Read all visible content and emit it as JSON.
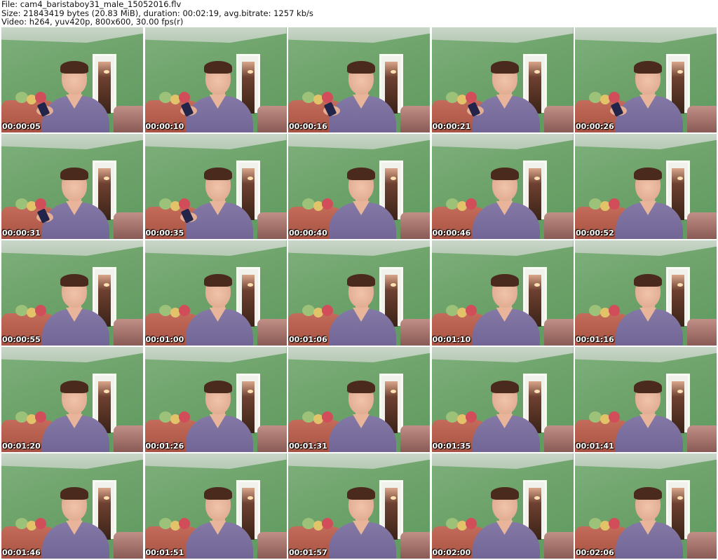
{
  "header": {
    "line1": "File: cam4_baristaboy31_male_15052016.flv",
    "line2": "Size: 21843419 bytes (20.83 MiB), duration: 00:02:19, avg.bitrate: 1257 kb/s",
    "line3": "Video: h264, yuv420p, 800x600, 30.00 fps(r)"
  },
  "frames": [
    {
      "timestamp": "00:00:05",
      "phone": true
    },
    {
      "timestamp": "00:00:10",
      "phone": true
    },
    {
      "timestamp": "00:00:16",
      "phone": true
    },
    {
      "timestamp": "00:00:21",
      "phone": true
    },
    {
      "timestamp": "00:00:26",
      "phone": true
    },
    {
      "timestamp": "00:00:31",
      "phone": true
    },
    {
      "timestamp": "00:00:35",
      "phone": true
    },
    {
      "timestamp": "00:00:40",
      "phone": false
    },
    {
      "timestamp": "00:00:46",
      "phone": false
    },
    {
      "timestamp": "00:00:52",
      "phone": false
    },
    {
      "timestamp": "00:00:55",
      "phone": false
    },
    {
      "timestamp": "00:01:00",
      "phone": false
    },
    {
      "timestamp": "00:01:06",
      "phone": false
    },
    {
      "timestamp": "00:01:10",
      "phone": false
    },
    {
      "timestamp": "00:01:16",
      "phone": false
    },
    {
      "timestamp": "00:01:20",
      "phone": false
    },
    {
      "timestamp": "00:01:26",
      "phone": false
    },
    {
      "timestamp": "00:01:31",
      "phone": false
    },
    {
      "timestamp": "00:01:35",
      "phone": false
    },
    {
      "timestamp": "00:01:41",
      "phone": false
    },
    {
      "timestamp": "00:01:46",
      "phone": false
    },
    {
      "timestamp": "00:01:51",
      "phone": false
    },
    {
      "timestamp": "00:01:57",
      "phone": false
    },
    {
      "timestamp": "00:02:00",
      "phone": false
    },
    {
      "timestamp": "00:02:06",
      "phone": false
    }
  ]
}
